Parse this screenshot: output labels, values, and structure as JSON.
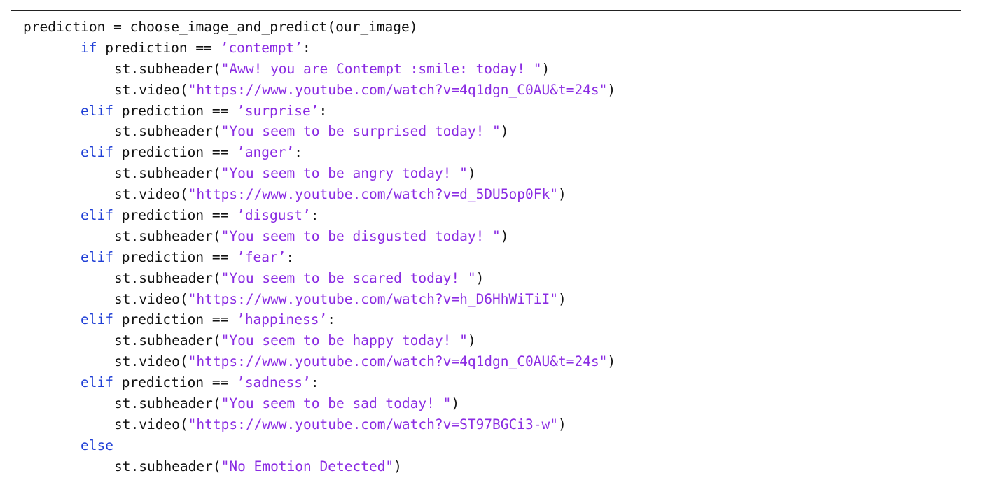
{
  "colors": {
    "keyword": "#1f3fd6",
    "string": "#8a2be2",
    "text": "#111111",
    "rule": "#222222"
  },
  "lines": [
    {
      "indent": 0,
      "tokens": [
        {
          "t": "text",
          "v": "prediction = choose_image_and_predict(our_image)"
        }
      ]
    },
    {
      "indent": 1,
      "tokens": [
        {
          "t": "kw",
          "v": "if"
        },
        {
          "t": "text",
          "v": " prediction == "
        },
        {
          "t": "str",
          "v": "’contempt’"
        },
        {
          "t": "text",
          "v": ":"
        }
      ]
    },
    {
      "indent": 2,
      "tokens": [
        {
          "t": "text",
          "v": "st.subheader("
        },
        {
          "t": "str",
          "v": "\"Aww! you are Contempt :smile: today! \""
        },
        {
          "t": "text",
          "v": ")"
        }
      ]
    },
    {
      "indent": 2,
      "tokens": [
        {
          "t": "text",
          "v": "st.video("
        },
        {
          "t": "str",
          "v": "\"https://www.youtube.com/watch?v=4q1dgn_C0AU&t=24s\""
        },
        {
          "t": "text",
          "v": ")"
        }
      ]
    },
    {
      "indent": 1,
      "tokens": [
        {
          "t": "kw",
          "v": "elif"
        },
        {
          "t": "text",
          "v": " prediction == "
        },
        {
          "t": "str",
          "v": "’surprise’"
        },
        {
          "t": "text",
          "v": ":"
        }
      ]
    },
    {
      "indent": 2,
      "tokens": [
        {
          "t": "text",
          "v": "st.subheader("
        },
        {
          "t": "str",
          "v": "\"You seem to be surprised today! \""
        },
        {
          "t": "text",
          "v": ")"
        }
      ]
    },
    {
      "indent": 1,
      "tokens": [
        {
          "t": "kw",
          "v": "elif"
        },
        {
          "t": "text",
          "v": " prediction == "
        },
        {
          "t": "str",
          "v": "’anger’"
        },
        {
          "t": "text",
          "v": ":"
        }
      ]
    },
    {
      "indent": 2,
      "tokens": [
        {
          "t": "text",
          "v": "st.subheader("
        },
        {
          "t": "str",
          "v": "\"You seem to be angry today! \""
        },
        {
          "t": "text",
          "v": ")"
        }
      ]
    },
    {
      "indent": 2,
      "tokens": [
        {
          "t": "text",
          "v": "st.video("
        },
        {
          "t": "str",
          "v": "\"https://www.youtube.com/watch?v=d_5DU5op0Fk\""
        },
        {
          "t": "text",
          "v": ")"
        }
      ]
    },
    {
      "indent": 1,
      "tokens": [
        {
          "t": "kw",
          "v": "elif"
        },
        {
          "t": "text",
          "v": " prediction == "
        },
        {
          "t": "str",
          "v": "’disgust’"
        },
        {
          "t": "text",
          "v": ":"
        }
      ]
    },
    {
      "indent": 2,
      "tokens": [
        {
          "t": "text",
          "v": "st.subheader("
        },
        {
          "t": "str",
          "v": "\"You seem to be disgusted today! \""
        },
        {
          "t": "text",
          "v": ")"
        }
      ]
    },
    {
      "indent": 1,
      "tokens": [
        {
          "t": "kw",
          "v": "elif"
        },
        {
          "t": "text",
          "v": " prediction == "
        },
        {
          "t": "str",
          "v": "’fear’"
        },
        {
          "t": "text",
          "v": ":"
        }
      ]
    },
    {
      "indent": 2,
      "tokens": [
        {
          "t": "text",
          "v": "st.subheader("
        },
        {
          "t": "str",
          "v": "\"You seem to be scared today! \""
        },
        {
          "t": "text",
          "v": ")"
        }
      ]
    },
    {
      "indent": 2,
      "tokens": [
        {
          "t": "text",
          "v": "st.video("
        },
        {
          "t": "str",
          "v": "\"https://www.youtube.com/watch?v=h_D6HhWiTiI\""
        },
        {
          "t": "text",
          "v": ")"
        }
      ]
    },
    {
      "indent": 1,
      "tokens": [
        {
          "t": "kw",
          "v": "elif"
        },
        {
          "t": "text",
          "v": " prediction == "
        },
        {
          "t": "str",
          "v": "’happiness’"
        },
        {
          "t": "text",
          "v": ":"
        }
      ]
    },
    {
      "indent": 2,
      "tokens": [
        {
          "t": "text",
          "v": "st.subheader("
        },
        {
          "t": "str",
          "v": "\"You seem to be happy today! \""
        },
        {
          "t": "text",
          "v": ")"
        }
      ]
    },
    {
      "indent": 2,
      "tokens": [
        {
          "t": "text",
          "v": "st.video("
        },
        {
          "t": "str",
          "v": "\"https://www.youtube.com/watch?v=4q1dgn_C0AU&t=24s\""
        },
        {
          "t": "text",
          "v": ")"
        }
      ]
    },
    {
      "indent": 1,
      "tokens": [
        {
          "t": "kw",
          "v": "elif"
        },
        {
          "t": "text",
          "v": " prediction == "
        },
        {
          "t": "str",
          "v": "’sadness’"
        },
        {
          "t": "text",
          "v": ":"
        }
      ]
    },
    {
      "indent": 2,
      "tokens": [
        {
          "t": "text",
          "v": "st.subheader("
        },
        {
          "t": "str",
          "v": "\"You seem to be sad today! \""
        },
        {
          "t": "text",
          "v": ")"
        }
      ]
    },
    {
      "indent": 2,
      "tokens": [
        {
          "t": "text",
          "v": "st.video("
        },
        {
          "t": "str",
          "v": "\"https://www.youtube.com/watch?v=ST97BGCi3-w\""
        },
        {
          "t": "text",
          "v": ")"
        }
      ]
    },
    {
      "indent": 1,
      "tokens": [
        {
          "t": "kw",
          "v": "else"
        }
      ]
    },
    {
      "indent": 2,
      "tokens": [
        {
          "t": "text",
          "v": "st.subheader("
        },
        {
          "t": "str",
          "v": "\"No Emotion Detected\""
        },
        {
          "t": "text",
          "v": ")"
        }
      ]
    }
  ]
}
